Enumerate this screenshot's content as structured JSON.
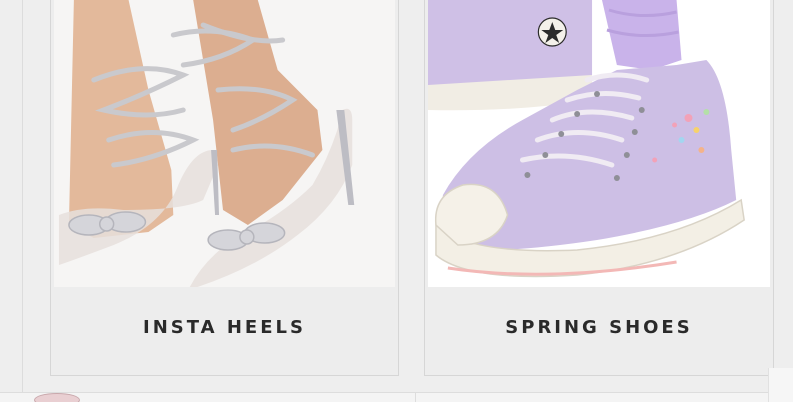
{
  "categories": [
    {
      "label": "INSTA HEELS",
      "image_alt": "clear heels with rhinestone straps and bows"
    },
    {
      "label": "SPRING SHOES",
      "image_alt": "lilac embroidered high-top sneakers"
    }
  ],
  "colors": {
    "page_background": "#eeeeee",
    "label_text": "#2a2a2a",
    "sneaker_lilac": "#cbbbe3",
    "rhinestone_silver": "#c9c9cd"
  },
  "icons": [
    "bottom-thumbnail-icon"
  ]
}
